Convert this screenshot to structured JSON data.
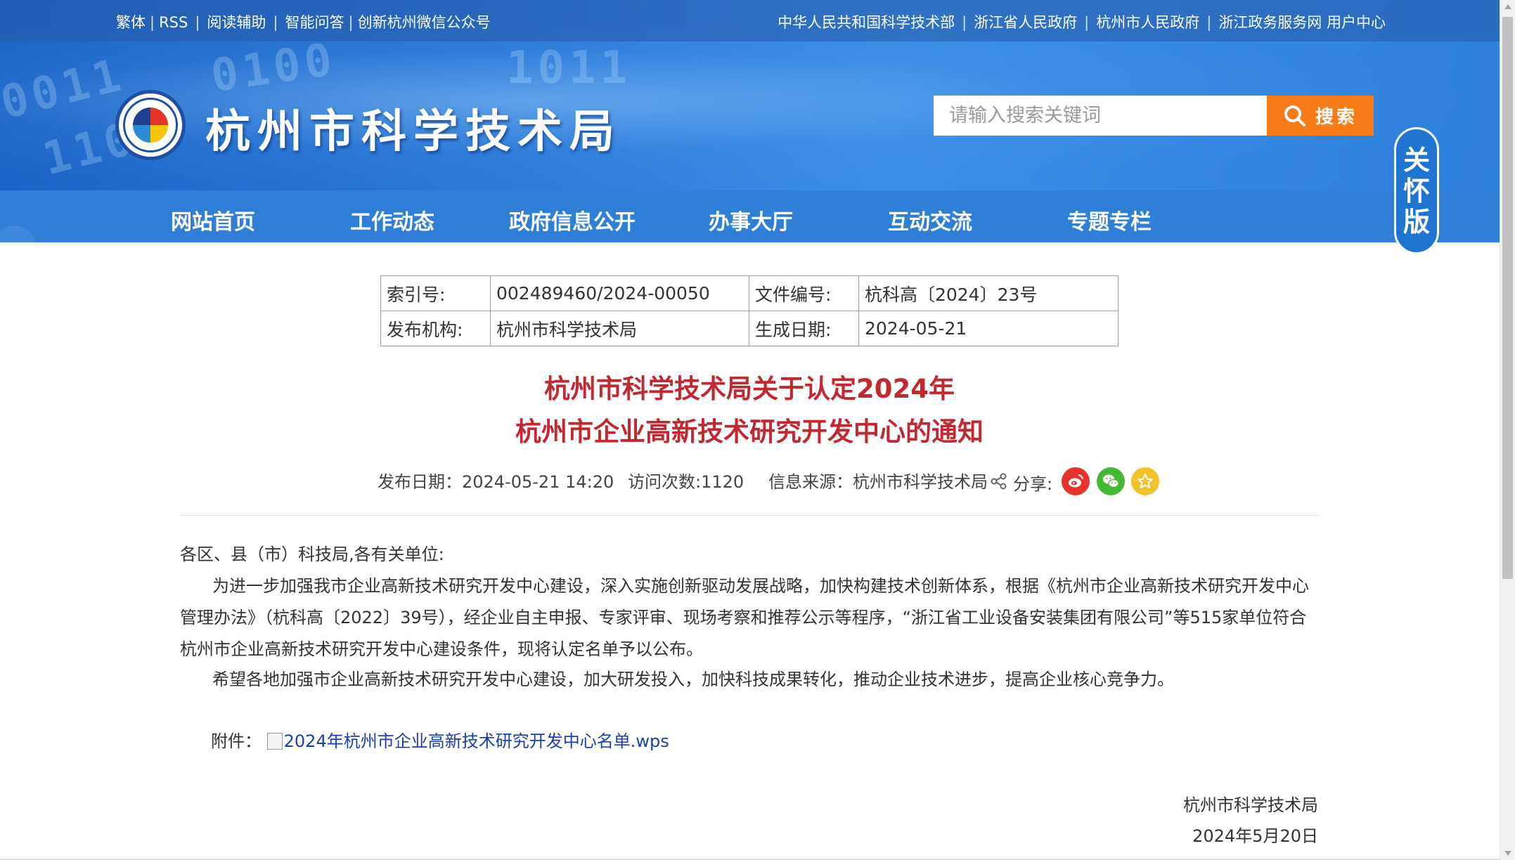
{
  "topbar": {
    "left_links": [
      "繁体",
      "RSS",
      "阅读辅助",
      "智能问答",
      "创新杭州微信公众号"
    ],
    "right_links": [
      "中华人民共和国科学技术部",
      "浙江省人民政府",
      "杭州市人民政府",
      "浙江政务服务网 用户中心"
    ]
  },
  "header": {
    "site_title": "杭州市科学技术局",
    "search_placeholder": "请输入搜索关键词",
    "search_button": "搜索",
    "care_badge": [
      "关",
      "怀",
      "版"
    ]
  },
  "nav": {
    "items": [
      "网站首页",
      "工作动态",
      "政府信息公开",
      "办事大厅",
      "互动交流",
      "专题专栏"
    ]
  },
  "meta": {
    "index_label": "索引号:",
    "index_value": "002489460/2024-00050",
    "doc_no_label": "文件编号:",
    "doc_no_value": "杭科高〔2024〕23号",
    "org_label": "发布机构:",
    "org_value": "杭州市科学技术局",
    "date_label": "生成日期:",
    "date_value": "2024-05-21"
  },
  "article": {
    "title_line1": "杭州市科学技术局关于认定2024年",
    "title_line2": "杭州市企业高新技术研究开发中心的通知",
    "publish_date": "发布日期：2024-05-21 14:20",
    "visits": "访问次数:1120",
    "source": "信息来源：杭州市科学技术局",
    "share_label": "分享:",
    "salutation": "各区、县（市）科技局,各有关单位:",
    "para1": "为进一步加强我市企业高新技术研究开发中心建设，深入实施创新驱动发展战略，加快构建技术创新体系，根据《杭州市企业高新技术研究开发中心管理办法》（杭科高〔2022〕39号），经企业自主申报、专家评审、现场考察和推荐公示等程序，“浙江省工业设备安装集团有限公司”等515家单位符合杭州市企业高新技术研究开发中心建设条件，现将认定名单予以公布。",
    "para2": "希望各地加强市企业高新技术研究开发中心建设，加大研发投入，加快科技成果转化，推动企业技术进步，提高企业核心竞争力。",
    "attachment_label": "附件：",
    "attachment_link": "2024年杭州市企业高新技术研究开发中心名单.wps",
    "signature_org": "杭州市科学技术局",
    "signature_date": "2024年5月20日"
  },
  "colors": {
    "banner_blue": "#2b7ad9",
    "nav_blue": "#2f7ed8",
    "search_orange": "#f77b17",
    "title_red": "#c2282f",
    "link_blue": "#1a3fb5",
    "weibo_red": "#e6342d",
    "wechat_green": "#43b935",
    "favorite_yellow": "#f3c12a"
  },
  "icons": [
    "logo-emblem",
    "search-icon",
    "share-icon",
    "weibo-icon",
    "wechat-icon",
    "favorite-icon",
    "file-icon"
  ]
}
